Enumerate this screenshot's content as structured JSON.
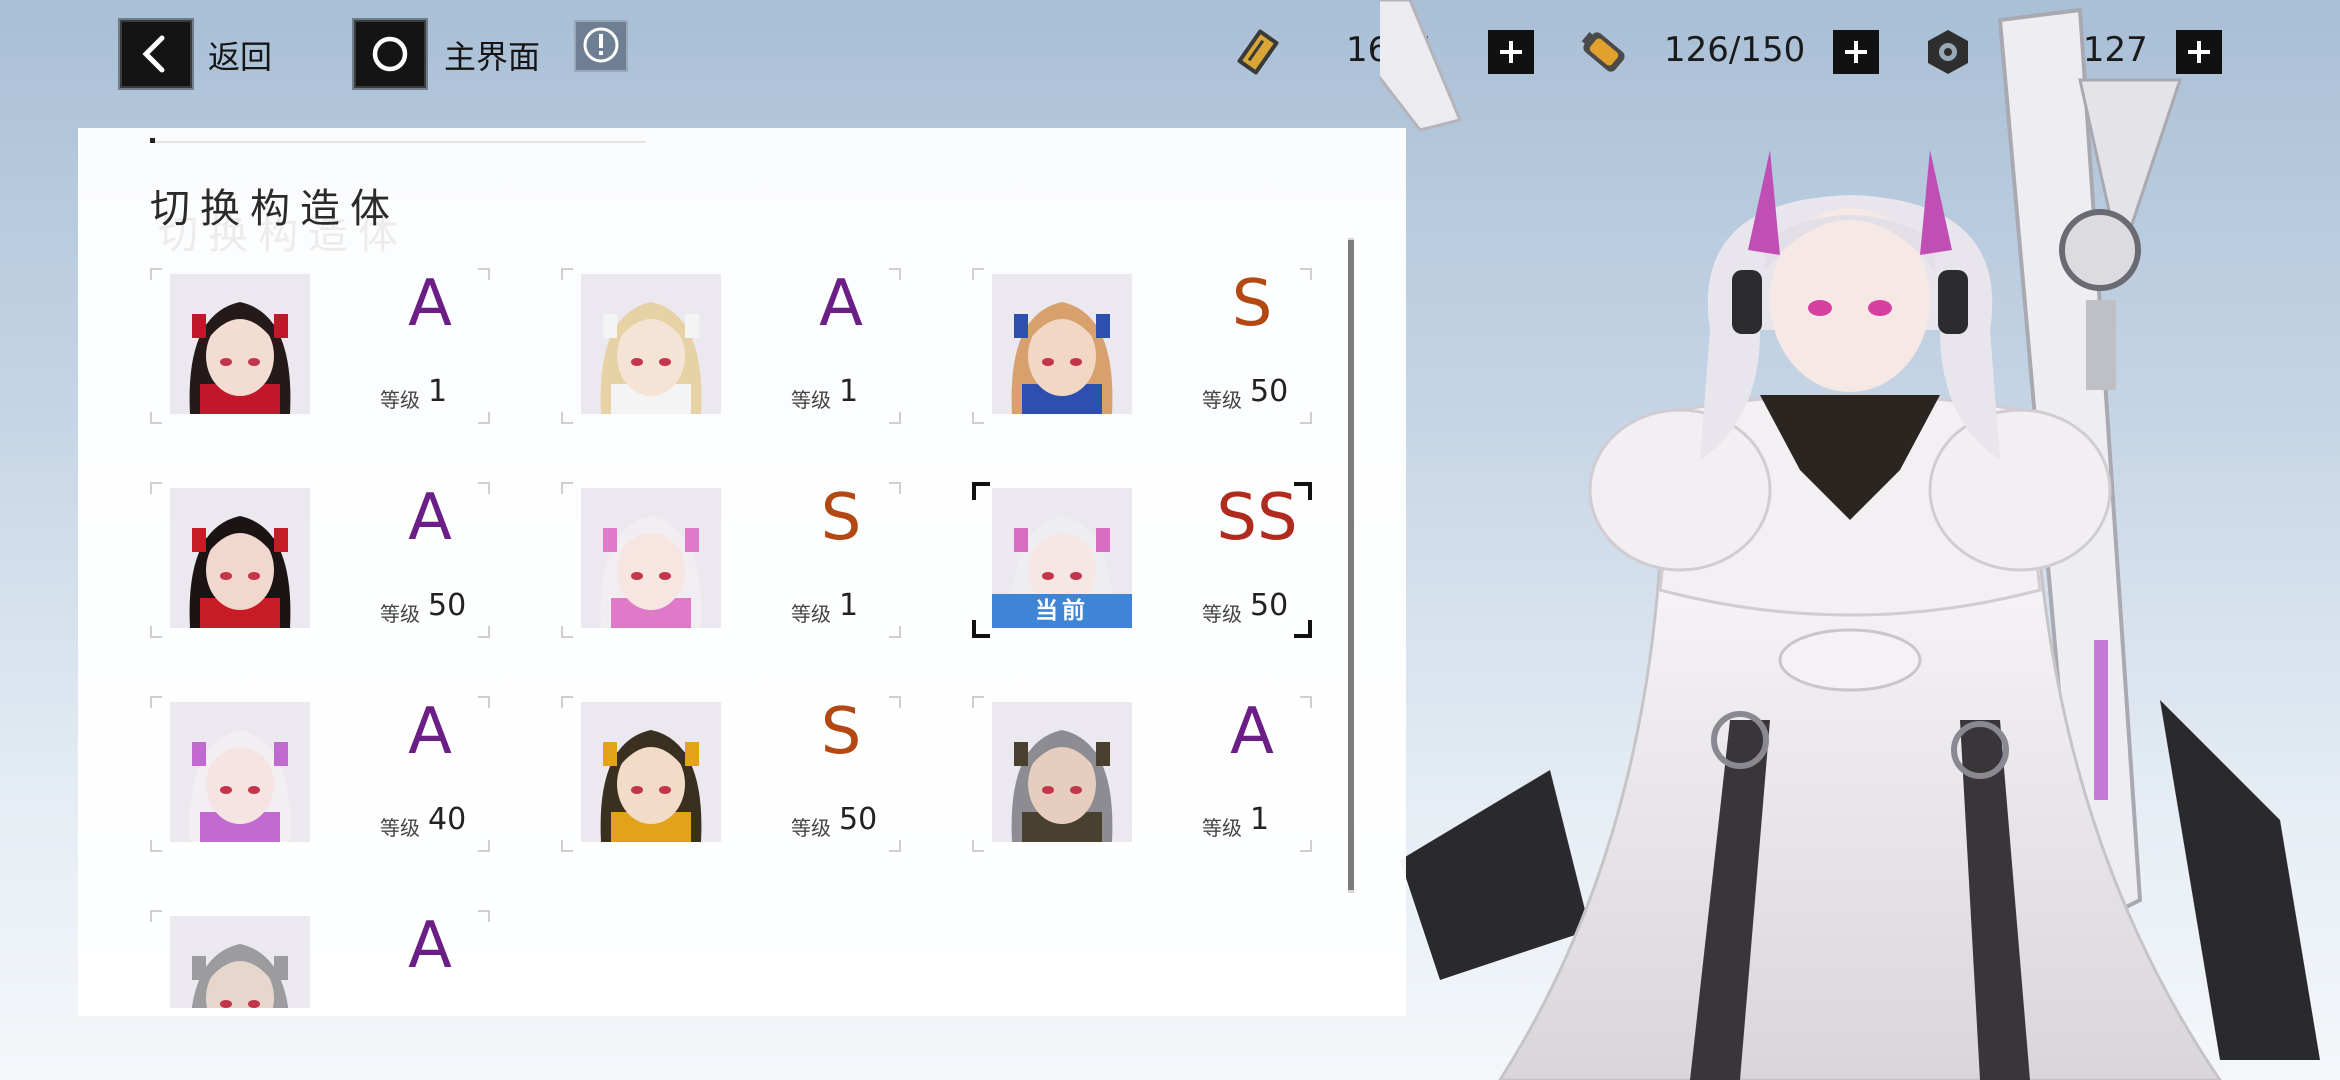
{
  "topbar": {
    "back_label": "返回",
    "home_label": "主界面",
    "resources": [
      {
        "name": "ticket",
        "value": "1645"
      },
      {
        "name": "stamina",
        "value": "126/150"
      },
      {
        "name": "coin",
        "value": "181127"
      }
    ]
  },
  "panel": {
    "title": "切换构造体",
    "level_label": "等级",
    "current_tag": "当前"
  },
  "characters": [
    {
      "rank": "A",
      "level": "1",
      "palette": {
        "hair": "#241a1a",
        "accent": "#c3162a",
        "skin": "#f3dcd2"
      }
    },
    {
      "rank": "A",
      "level": "1",
      "palette": {
        "hair": "#e6d2a4",
        "accent": "#f4f4f4",
        "skin": "#f5e3d6"
      }
    },
    {
      "rank": "S",
      "level": "50",
      "palette": {
        "hair": "#d7a06c",
        "accent": "#2d4fb0",
        "skin": "#f1d7c4"
      }
    },
    {
      "rank": "A",
      "level": "50",
      "palette": {
        "hair": "#1c1414",
        "accent": "#c71c26",
        "skin": "#f1d7ce"
      }
    },
    {
      "rank": "S",
      "level": "1",
      "palette": {
        "hair": "#f1edf1",
        "accent": "#e07ac8",
        "skin": "#f7e5e2"
      }
    },
    {
      "rank": "SS",
      "level": "50",
      "palette": {
        "hair": "#eeeef2",
        "accent": "#d86bc2",
        "skin": "#f7e7e4"
      },
      "current": true
    },
    {
      "rank": "A",
      "level": "40",
      "palette": {
        "hair": "#f2eef2",
        "accent": "#c06ad0",
        "skin": "#f6e4e2"
      }
    },
    {
      "rank": "S",
      "level": "50",
      "palette": {
        "hair": "#3a3020",
        "accent": "#e2a31a",
        "skin": "#f2dcc8"
      }
    },
    {
      "rank": "A",
      "level": "1",
      "palette": {
        "hair": "#8c8c92",
        "accent": "#4a4030",
        "skin": "#e6cdbd"
      }
    },
    {
      "rank": "A",
      "level": "",
      "palette": {
        "hair": "#9c9c9e",
        "accent": "#9c9c9e",
        "skin": "#e6d6cc"
      }
    }
  ]
}
